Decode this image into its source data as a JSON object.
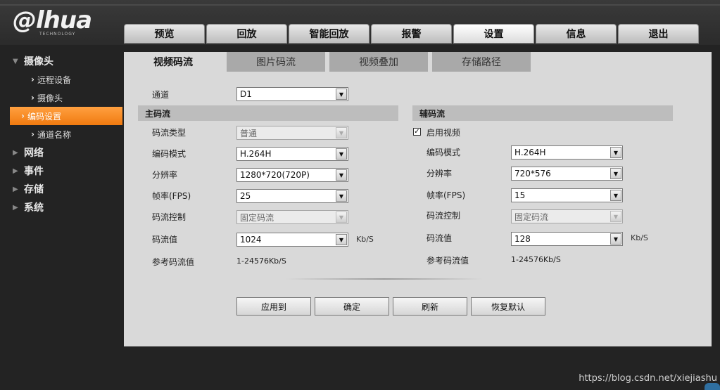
{
  "brand": {
    "logo_text": "alhua",
    "logo_sub": "TECHNOLOGY"
  },
  "nav": {
    "tabs": [
      "预览",
      "回放",
      "智能回放",
      "报警",
      "设置",
      "信息",
      "退出"
    ],
    "active_index": 4
  },
  "sidebar": {
    "groups": [
      {
        "label": "摄像头",
        "expanded": true,
        "items": [
          "远程设备",
          "摄像头",
          "编码设置",
          "通道名称"
        ]
      },
      {
        "label": "网络",
        "expanded": false
      },
      {
        "label": "事件",
        "expanded": false
      },
      {
        "label": "存储",
        "expanded": false
      },
      {
        "label": "系统",
        "expanded": false
      }
    ],
    "active_item": "编码设置"
  },
  "subtabs": {
    "items": [
      "视频码流",
      "图片码流",
      "视频叠加",
      "存储路径"
    ],
    "active_index": 0
  },
  "channel": {
    "label": "通道",
    "value": "D1"
  },
  "main_stream": {
    "title": "主码流",
    "type_label": "码流类型",
    "type_value": "普通",
    "mode_label": "编码模式",
    "mode_value": "H.264H",
    "res_label": "分辨率",
    "res_value": "1280*720(720P)",
    "fps_label": "帧率(FPS)",
    "fps_value": "25",
    "ctrl_label": "码流控制",
    "ctrl_value": "固定码流",
    "bitrate_label": "码流值",
    "bitrate_value": "1024",
    "bitrate_unit": "Kb/S",
    "ref_label": "参考码流值",
    "ref_value": "1-24576Kb/S"
  },
  "sub_stream": {
    "title": "辅码流",
    "enable_label": "启用视频",
    "enable_mark": "✓",
    "mode_label": "编码模式",
    "mode_value": "H.264H",
    "res_label": "分辨率",
    "res_value": "720*576",
    "fps_label": "帧率(FPS)",
    "fps_value": "15",
    "ctrl_label": "码流控制",
    "ctrl_value": "固定码流",
    "bitrate_label": "码流值",
    "bitrate_value": "128",
    "bitrate_unit": "Kb/S",
    "ref_label": "参考码流值",
    "ref_value": "1-24576Kb/S"
  },
  "buttons": {
    "apply_to": "应用到",
    "ok": "确定",
    "refresh": "刷新",
    "default": "恢复默认"
  },
  "watermark": "https://blog.csdn.net/xiejiashu",
  "colors": {
    "accent": "#f28a20",
    "panel": "#d9d9d9",
    "background": "#232323"
  }
}
